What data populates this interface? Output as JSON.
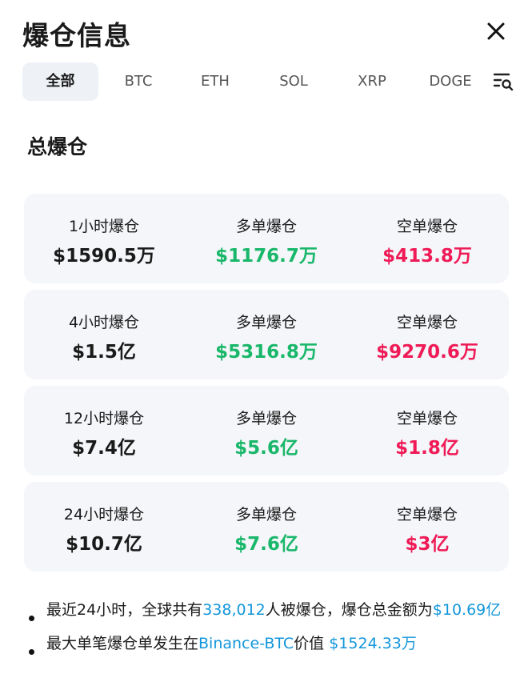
{
  "header": {
    "title": "爆仓信息"
  },
  "tabs": [
    {
      "label": "全部",
      "active": true
    },
    {
      "label": "BTC"
    },
    {
      "label": "ETH"
    },
    {
      "label": "SOL"
    },
    {
      "label": "XRP"
    },
    {
      "label": "DOGE"
    }
  ],
  "section_title": "总爆仓",
  "cards": [
    {
      "total_label": "1小时爆仓",
      "total_value": "$1590.5万",
      "long_label": "多单爆仓",
      "long_value": "$1176.7万",
      "short_label": "空单爆仓",
      "short_value": "$413.8万"
    },
    {
      "total_label": "4小时爆仓",
      "total_value": "$1.5亿",
      "long_label": "多单爆仓",
      "long_value": "$5316.8万",
      "short_label": "空单爆仓",
      "short_value": "$9270.6万"
    },
    {
      "total_label": "12小时爆仓",
      "total_value": "$7.4亿",
      "long_label": "多单爆仓",
      "long_value": "$5.6亿",
      "short_label": "空单爆仓",
      "short_value": "$1.8亿"
    },
    {
      "total_label": "24小时爆仓",
      "total_value": "$10.7亿",
      "long_label": "多单爆仓",
      "long_value": "$7.6亿",
      "short_label": "空单爆仓",
      "short_value": "$3亿"
    }
  ],
  "notes": {
    "n1_a": "最近24小时，全球共有",
    "n1_count": "338,012",
    "n1_b": "人被爆仓，爆仓总金额为",
    "n1_amount": "$10.69亿",
    "n2_a": "最大单笔爆仓单发生在",
    "n2_exchange": "Binance-BTC",
    "n2_b": "价值 ",
    "n2_amount": "$1524.33万"
  },
  "colors": {
    "long": "#19b76a",
    "short": "#ef1b57",
    "accent": "#1296db"
  },
  "icons": {
    "close": "close-icon",
    "filter": "filter-search-icon"
  }
}
